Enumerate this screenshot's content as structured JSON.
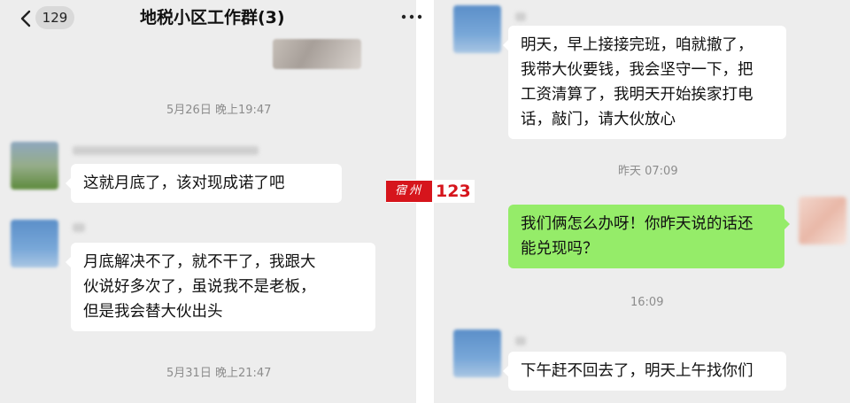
{
  "header": {
    "unread_count": "129",
    "title": "地税小区工作群(3)"
  },
  "left": {
    "timestamp_1": "5月26日 晚上19:47",
    "msg_1": [
      "这就月底了，该对现成诺了吧"
    ],
    "msg_2": [
      "月底解决不了，就不干了，我跟大",
      "伙说好多次了，虽说我不是老板，",
      "但是我会替大伙出头"
    ],
    "timestamp_2": "5月31日 晚上21:47"
  },
  "right": {
    "msg_1": [
      "明天，早上接接完班，咱就撤了，",
      "我带大伙要钱，我会坚守一下，把",
      "工资清算了，我明天开始挨家打电",
      "话，敲门，请大伙放心"
    ],
    "timestamp_1": "昨天 07:09",
    "msg_2": [
      "我们俩怎么办呀！你昨天说的话还",
      "能兑现吗？"
    ],
    "timestamp_2": "16:09",
    "msg_3": [
      "下午赶不回去了，明天上午找你们"
    ]
  },
  "watermark": {
    "seal_text": "宿州",
    "number": "123"
  },
  "icons": {
    "back": "chevron-left-icon",
    "more": "more-dots-icon"
  },
  "colors": {
    "background": "#ededed",
    "incoming_bubble": "#ffffff",
    "outgoing_bubble": "#95ec69",
    "watermark_red": "#d6151c"
  }
}
